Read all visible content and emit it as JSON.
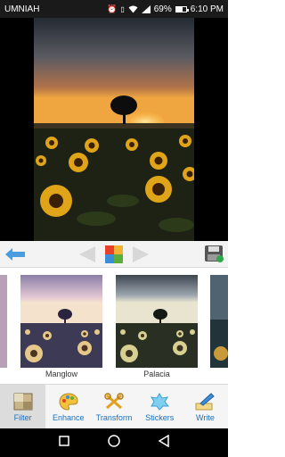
{
  "status_bar": {
    "carrier": "UMNIAH",
    "battery": "69%",
    "time": "6:10 PM",
    "battery_level": 0.69
  },
  "toolbar": {
    "back_icon": "back-arrow-icon",
    "prev_icon": "prev-triangle-icon",
    "compare_icon": "compare-icon",
    "next_icon": "next-triangle-icon",
    "save_icon": "save-icon"
  },
  "filters": {
    "items": [
      {
        "label": ""
      },
      {
        "label": "Manglow"
      },
      {
        "label": "Palacia"
      },
      {
        "label": ""
      }
    ]
  },
  "tabs": [
    {
      "label": "Filter",
      "icon": "filter-icon",
      "active": true
    },
    {
      "label": "Enhance",
      "icon": "palette-icon",
      "active": false
    },
    {
      "label": "Transform",
      "icon": "transform-icon",
      "active": false
    },
    {
      "label": "Stickers",
      "icon": "sticker-icon",
      "active": false
    },
    {
      "label": "Write",
      "icon": "write-icon",
      "active": false
    }
  ],
  "nav": {
    "square": "recents-icon",
    "circle": "home-icon",
    "triangle": "back-icon"
  }
}
